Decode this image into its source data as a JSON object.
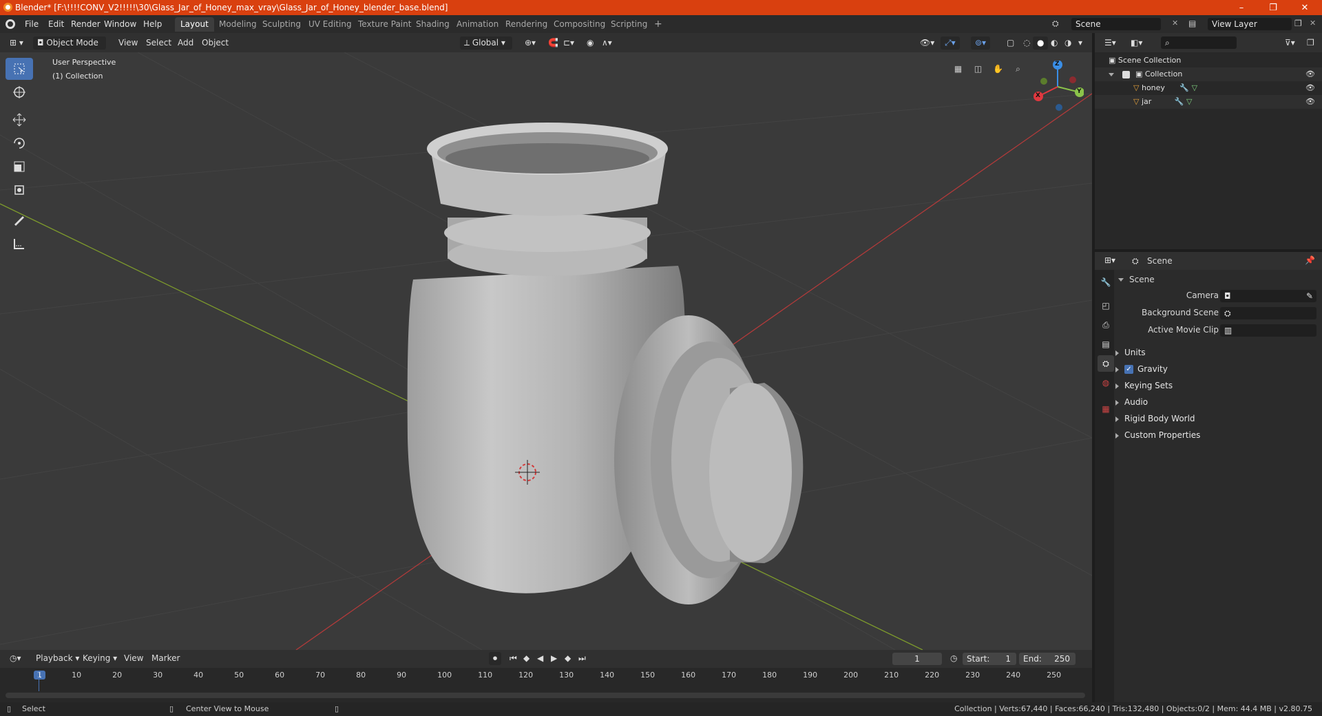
{
  "window": {
    "title": "Blender* [F:\\!!!!CONV_V2!!!!!\\30\\Glass_Jar_of_Honey_max_vray\\Glass_Jar_of_Honey_blender_base.blend]",
    "minimize": "–",
    "maximize": "❐",
    "close": "✕"
  },
  "menu": [
    "File",
    "Edit",
    "Render",
    "Window",
    "Help"
  ],
  "workspaces": [
    "Layout",
    "Modeling",
    "Sculpting",
    "UV Editing",
    "Texture Paint",
    "Shading",
    "Animation",
    "Rendering",
    "Compositing",
    "Scripting"
  ],
  "workspace_add": "+",
  "scene_field": "Scene",
  "view_layer_field": "View Layer",
  "viewport_header": {
    "mode": "Object Mode",
    "menus": [
      "View",
      "Select",
      "Add",
      "Object"
    ],
    "transform_orientation": "Global"
  },
  "viewport": {
    "view_name": "User Perspective",
    "collection_label": "(1) Collection",
    "gizmo_axes": {
      "z": "Z",
      "y": "Y",
      "x": "X"
    }
  },
  "outliner": {
    "search_placeholder": "",
    "rows": [
      {
        "label": "Scene Collection"
      },
      {
        "label": "Collection"
      },
      {
        "label": "honey"
      },
      {
        "label": "jar"
      }
    ]
  },
  "properties": {
    "context": "Scene",
    "panel_title": "Scene",
    "camera_label": "Camera",
    "background_scene_label": "Background Scene",
    "active_movie_clip_label": "Active Movie Clip",
    "sections": [
      "Units",
      "Gravity",
      "Keying Sets",
      "Audio",
      "Rigid Body World",
      "Custom Properties"
    ],
    "gravity_checked": true
  },
  "timeline": {
    "menus": [
      "Playback",
      "Keying",
      "View",
      "Marker"
    ],
    "current_frame": "1",
    "start_label": "Start:",
    "start_value": "1",
    "end_label": "End:",
    "end_value": "250",
    "ticks": [
      "1",
      "10",
      "20",
      "30",
      "40",
      "50",
      "60",
      "70",
      "80",
      "90",
      "100",
      "110",
      "120",
      "130",
      "140",
      "150",
      "160",
      "170",
      "180",
      "190",
      "200",
      "210",
      "220",
      "230",
      "240",
      "250"
    ]
  },
  "statusbar": {
    "left_action": "Select",
    "middle_action": "Center View to Mouse",
    "stats": "Collection | Verts:67,440 | Faces:66,240 | Tris:132,480 | Objects:0/2 | Mem: 44.4 MB | v2.80.75"
  },
  "colors": {
    "titlebar": "#d9400f",
    "accent": "#4772b3",
    "x_axis": "#e0383f",
    "y_axis": "#8bc34a",
    "z_axis": "#3a8ee6",
    "object_orange": "#e8a33c"
  }
}
